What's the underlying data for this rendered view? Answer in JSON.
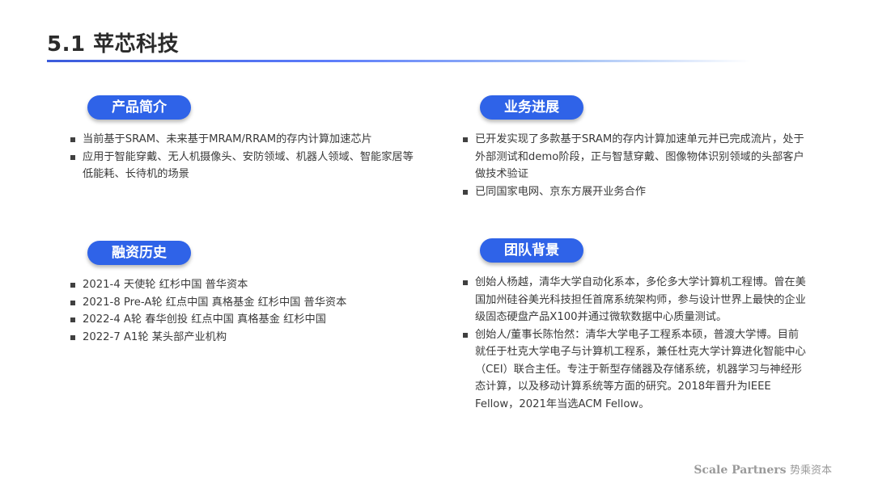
{
  "page": {
    "title": "5.1 苹芯科技"
  },
  "sections": {
    "product": {
      "heading": "产品简介",
      "items": [
        "当前基于SRAM、未来基于MRAM/RRAM的存内计算加速芯片",
        "应用于智能穿戴、无人机摄像头、安防领域、机器人领域、智能家居等低能耗、长待机的场景"
      ]
    },
    "business": {
      "heading": "业务进展",
      "items": [
        "已开发实现了多款基于SRAM的存内计算加速单元并已完成流片，处于外部测试和demo阶段，正与智慧穿戴、图像物体识别领域的头部客户做技术验证",
        "已同国家电网、京东方展开业务合作"
      ]
    },
    "funding": {
      "heading": "融资历史",
      "items": [
        "2021-4 天使轮 红杉中国 普华资本",
        "2021-8 Pre-A轮 红点中国 真格基金 红杉中国 普华资本",
        "2022-4 A轮 春华创投 红点中国 真格基金 红杉中国",
        "2022-7 A1轮 某头部产业机构"
      ]
    },
    "team": {
      "heading": "团队背景",
      "items": [
        "创始人杨越，清华大学自动化系本，多伦多大学计算机工程博。曾在美国加州硅谷美光科技担任首席系统架构师，参与设计世界上最快的企业级固态硬盘产品X100并通过微软数据中心质量测试。",
        "创始人/董事长陈怡然：清华大学电子工程系本硕，普渡大学博。目前就任于杜克大学电子与计算机工程系，兼任杜克大学计算进化智能中心（CEI）联合主任。专注于新型存储器及存储系统，机器学习与神经形态计算，以及移动计算系统等方面的研究。2018年晋升为IEEE Fellow，2021年当选ACM Fellow。"
      ]
    }
  },
  "footer": {
    "brand_en": "Scale Partners",
    "brand_cn": "势乘资本"
  }
}
